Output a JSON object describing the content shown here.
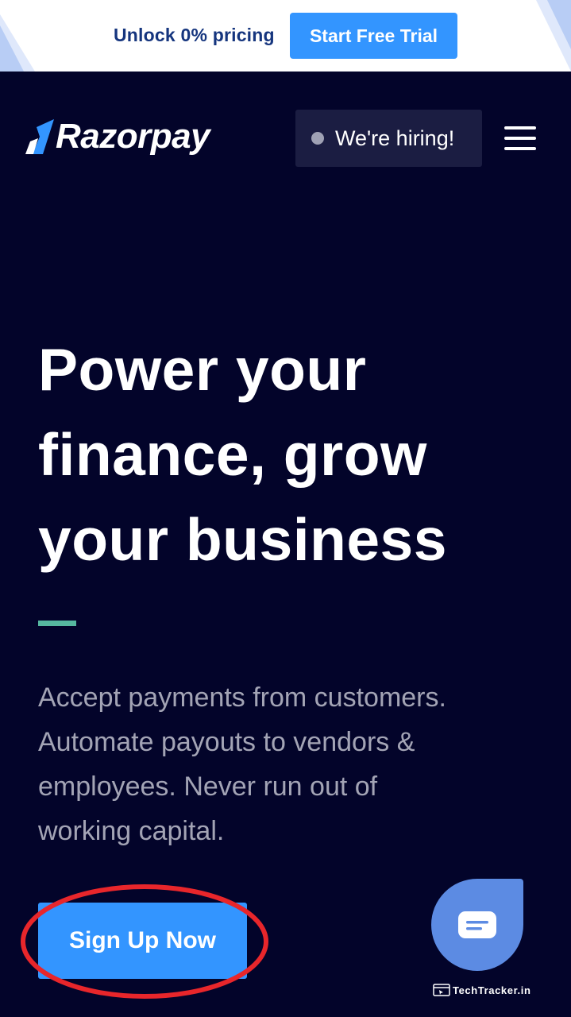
{
  "promo": {
    "text": "Unlock 0% pricing",
    "cta_label": "Start Free Trial"
  },
  "header": {
    "logo_text": "Razorpay",
    "hiring_label": "We're hiring!",
    "menu_icon": "hamburger-menu-icon"
  },
  "hero": {
    "title_lines": [
      "Power your",
      "finance, grow",
      "your business"
    ],
    "subtitle_lines": [
      "Accept payments from customers.",
      "Automate payouts to vendors &",
      "employees. Never run out of",
      "working capital."
    ],
    "cta_label": "Sign Up Now"
  },
  "chat": {
    "icon": "chat-bubble-icon"
  },
  "watermark": {
    "text": "TechTracker.in"
  },
  "colors": {
    "background": "#03042a",
    "accent_blue": "#3395ff",
    "divider_teal": "#56b8a0",
    "highlight_red": "#e8262b",
    "chat_blue": "#5c8be3"
  }
}
